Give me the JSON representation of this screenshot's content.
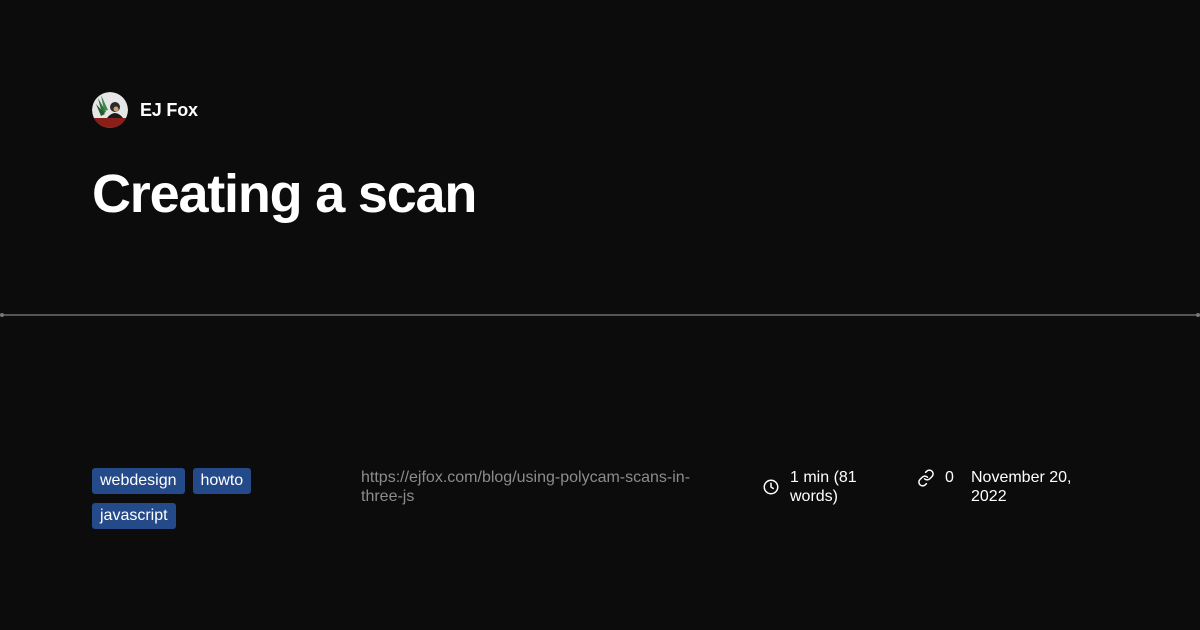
{
  "author": {
    "name": "EJ Fox",
    "avatar_icon": "avatar-illustration"
  },
  "post": {
    "title": "Creating a scan",
    "url": "https://ejfox.com/blog/using-polycam-scans-in-three-js",
    "reading_time": "1 min (81 words)",
    "link_count": "0",
    "date": "November 20, 2022"
  },
  "tags": [
    "webdesign",
    "howto",
    "javascript"
  ],
  "icons": {
    "reading_time": "clock-icon",
    "links": "link-icon"
  },
  "colors": {
    "background": "#0c0c0c",
    "tag_background": "#244a8a",
    "url_text": "#8c8c8c",
    "divider": "#555555"
  }
}
